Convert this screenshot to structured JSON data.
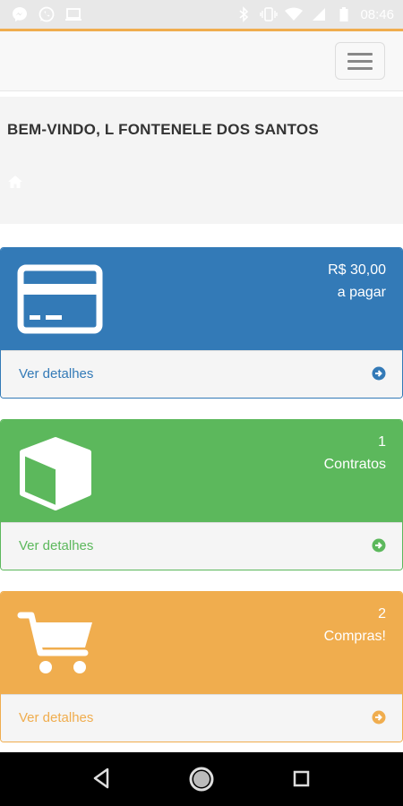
{
  "status_bar": {
    "time": "08:46",
    "left_icons": [
      "messenger-icon",
      "whatsapp-icon",
      "laptop-icon"
    ],
    "right_icons": [
      "bluetooth-icon",
      "vibrate-icon",
      "wifi-icon",
      "signal-icon",
      "battery-icon"
    ]
  },
  "colors": {
    "accent": "#f0ad4e",
    "primary": "#337ab7",
    "success": "#5cb85c",
    "warning": "#f0ad4e"
  },
  "header": {
    "welcome_text": "BEM-VINDO, L FONTENELE DOS SANTOS",
    "menu_icon": "hamburger-icon",
    "home_icon": "home-icon"
  },
  "panels": [
    {
      "count": "R$ 30,00",
      "subtitle": "a pagar",
      "icon": "credit-card-icon",
      "footer_label": "Ver detalhes",
      "arrow_icon": "arrow-circle-right-icon"
    },
    {
      "count": "1",
      "subtitle": "Contratos",
      "icon": "cube-icon",
      "footer_label": "Ver detalhes",
      "arrow_icon": "arrow-circle-right-icon"
    },
    {
      "count": "2",
      "subtitle": "Compras!",
      "icon": "shopping-cart-icon",
      "footer_label": "Ver detalhes",
      "arrow_icon": "arrow-circle-right-icon"
    }
  ],
  "system_nav": [
    "back-icon",
    "home-circle-icon",
    "recents-icon"
  ]
}
